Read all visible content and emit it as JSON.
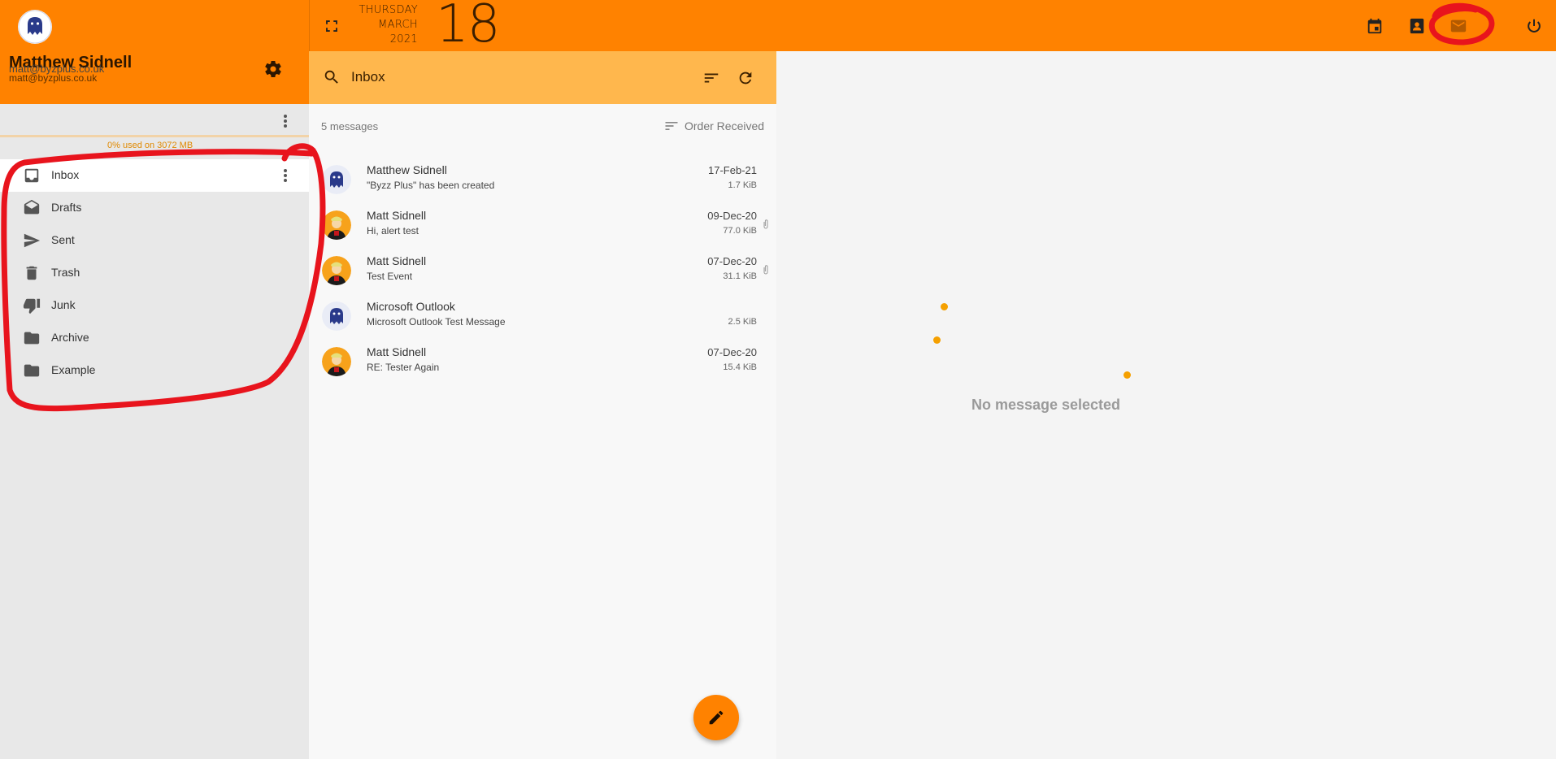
{
  "header": {
    "weekday": "THURSDAY",
    "month": "MARCH",
    "year": "2021",
    "day": "18",
    "accent_color": "#ff8200"
  },
  "top_icons": [
    "calendar-icon",
    "contacts-icon",
    "mail-icon",
    "power-icon"
  ],
  "profile": {
    "name": "Matthew Sidnell",
    "email": "matt@byzplus.co.uk"
  },
  "account": {
    "email": "matt@byzplus.co.uk",
    "quota_text": "0% used on 3072 MB",
    "quota_fraction": 0.0
  },
  "folders": [
    {
      "label": "Inbox",
      "icon": "inbox-icon",
      "active": true
    },
    {
      "label": "Drafts",
      "icon": "drafts-icon",
      "active": false
    },
    {
      "label": "Sent",
      "icon": "send-icon",
      "active": false
    },
    {
      "label": "Trash",
      "icon": "trash-icon",
      "active": false
    },
    {
      "label": "Junk",
      "icon": "thumb-down-icon",
      "active": false
    },
    {
      "label": "Archive",
      "icon": "folder-icon",
      "active": false
    },
    {
      "label": "Example",
      "icon": "folder-icon",
      "active": false
    }
  ],
  "search": {
    "value": "Inbox",
    "placeholder": "Inbox"
  },
  "list": {
    "count_text": "5 messages",
    "order_label": "Order Received"
  },
  "messages": [
    {
      "from": "Matthew Sidnell",
      "subject": "\"Byzz Plus\" has been created",
      "date": "17-Feb-21",
      "size": "1.7 KiB",
      "attachment": false,
      "avatar": "ghost"
    },
    {
      "from": "Matt Sidnell",
      "subject": "Hi, alert test",
      "date": "09-Dec-20",
      "size": "77.0 KiB",
      "attachment": true,
      "avatar": "person"
    },
    {
      "from": "Matt Sidnell",
      "subject": "Test Event",
      "date": "07-Dec-20",
      "size": "31.1 KiB",
      "attachment": true,
      "avatar": "person"
    },
    {
      "from": "Microsoft Outlook",
      "subject": "Microsoft Outlook Test Message",
      "date": "",
      "size": "2.5 KiB",
      "attachment": false,
      "avatar": "ghost"
    },
    {
      "from": "Matt Sidnell",
      "subject": "RE: Tester Again",
      "date": "07-Dec-20",
      "size": "15.4 KiB",
      "attachment": false,
      "avatar": "person"
    }
  ],
  "reading": {
    "empty_text": "No message selected"
  }
}
